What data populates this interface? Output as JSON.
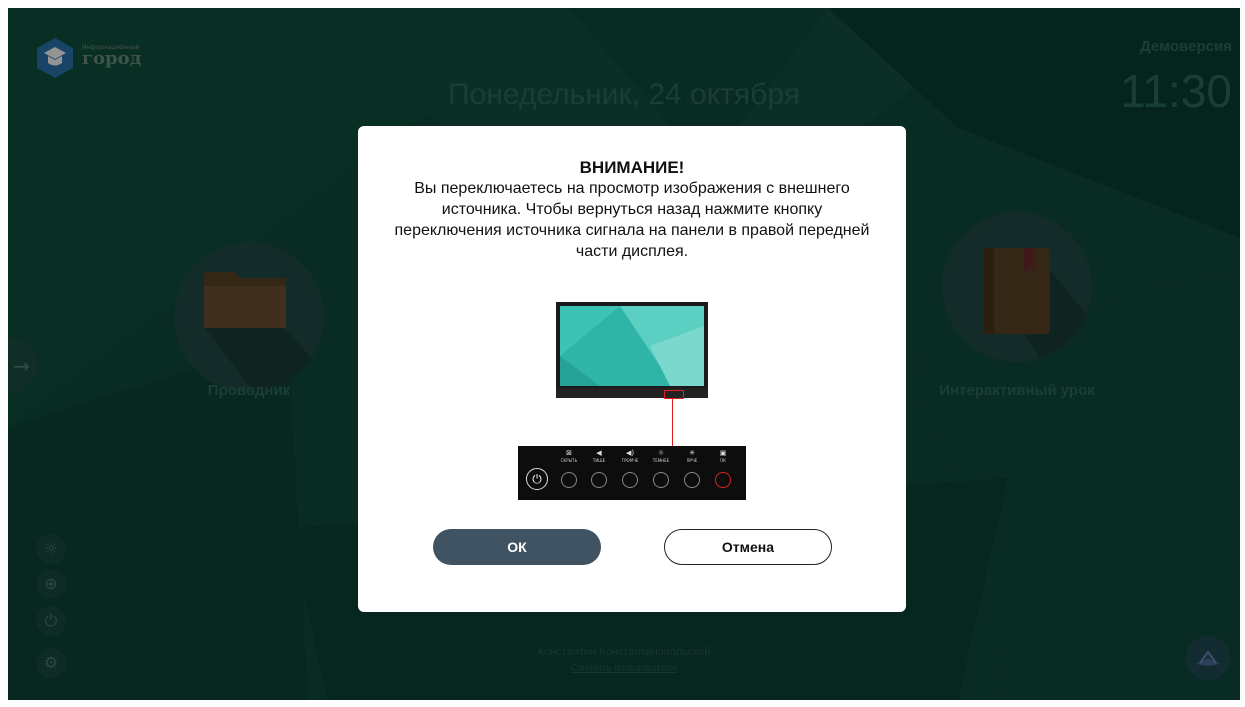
{
  "header": {
    "logo_small": "Информационный",
    "logo_text": "город",
    "date": "Понедельник, 24 октября",
    "demo": "Демоверсия",
    "clock": "11:30"
  },
  "tiles": {
    "explorer_label": "Проводник",
    "lesson_label": "Интерактивный урок"
  },
  "footer": {
    "user_name": "Константин Константинопольский",
    "change_user": "Сменить пользователя"
  },
  "dialog": {
    "title": "ВНИМАНИЕ!",
    "body": "Вы переключаетесь на просмотр изображения с внешнего источника. Чтобы вернуться назад нажмите кнопку переключения источника сигнала на панели в правой передней части дисплея.",
    "panel_labels": [
      "СКРЫТЬ",
      "ТИШЕ",
      "ГРОМЧЕ",
      "ТЕМНЕЕ",
      "ЯРЧЕ",
      "ПК"
    ],
    "ok_label": "ОК",
    "cancel_label": "Отмена"
  },
  "colors": {
    "background": "#0f4d3f",
    "ok_button": "#405362",
    "source_highlight": "#e02020"
  }
}
